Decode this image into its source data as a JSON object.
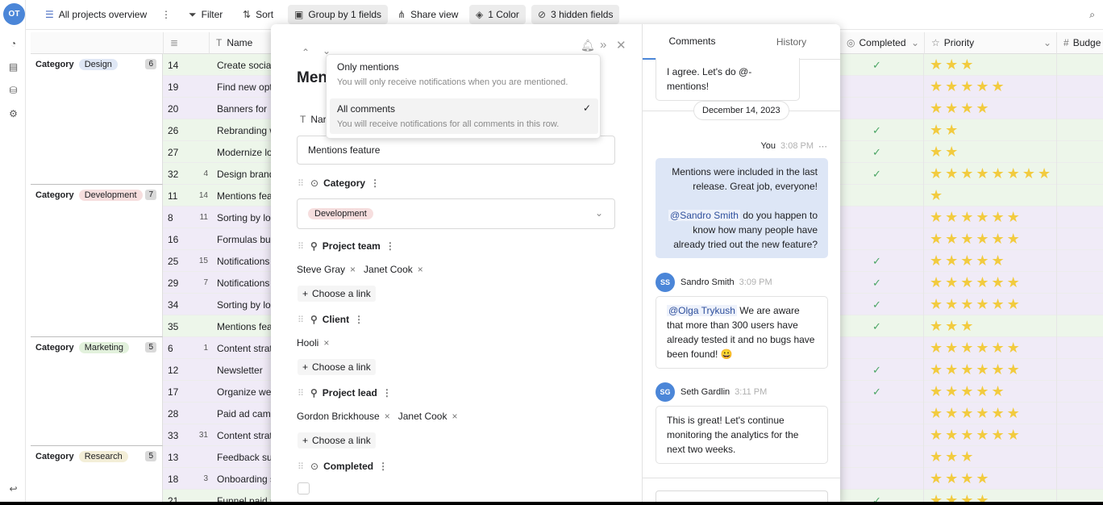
{
  "rail": {
    "avatar": "OT"
  },
  "toolbar": {
    "view_name": "All projects overview",
    "filter": "Filter",
    "sort": "Sort",
    "group": "Group by 1 fields",
    "share": "Share view",
    "color": "1 Color",
    "hidden": "3 hidden fields"
  },
  "grid": {
    "headers": {
      "name": "Name",
      "completed": "Completed",
      "priority": "Priority",
      "budget": "Budge"
    },
    "groups": [
      {
        "label": "Category",
        "value": "Design",
        "count": "6",
        "pill_color": "#dfe7f5",
        "rows": [
          {
            "id": "14",
            "count": "",
            "name": "Create social",
            "completed": "✓",
            "stars": "★★★",
            "tint": "#edf6ea"
          },
          {
            "id": "19",
            "count": "",
            "name": "Find new opt",
            "completed": "",
            "stars": "★★★★★",
            "tint": "#f0ebf7"
          },
          {
            "id": "20",
            "count": "",
            "name": "Banners for",
            "completed": "",
            "stars": "★★★★",
            "tint": "#f0ebf7"
          },
          {
            "id": "26",
            "count": "",
            "name": "Rebranding w",
            "completed": "✓",
            "stars": "★★",
            "tint": "#edf6ea"
          },
          {
            "id": "27",
            "count": "",
            "name": "Modernize lo",
            "completed": "✓",
            "stars": "★★",
            "tint": "#edf6ea"
          },
          {
            "id": "32",
            "count": "4",
            "name": "Design brand",
            "completed": "✓",
            "stars": "★★★★★★★★",
            "tint": "#edf6ea"
          }
        ]
      },
      {
        "label": "Category",
        "value": "Development",
        "count": "7",
        "pill_color": "#f6dede",
        "rows": [
          {
            "id": "11",
            "count": "14",
            "name": "Mentions fea",
            "completed": "",
            "stars": "★",
            "tint": "#edf6ea"
          },
          {
            "id": "8",
            "count": "11",
            "name": "Sorting by lo",
            "completed": "",
            "stars": "★★★★★★",
            "tint": "#f0ebf7"
          },
          {
            "id": "16",
            "count": "",
            "name": "Formulas bug",
            "completed": "",
            "stars": "★★★★★★",
            "tint": "#f0ebf7"
          },
          {
            "id": "25",
            "count": "15",
            "name": "Notifications",
            "completed": "✓",
            "stars": "★★★★★",
            "tint": "#f0ebf7"
          },
          {
            "id": "29",
            "count": "7",
            "name": "Notifications",
            "completed": "✓",
            "stars": "★★★★★★",
            "tint": "#f0ebf7"
          },
          {
            "id": "34",
            "count": "",
            "name": "Sorting by lo",
            "completed": "✓",
            "stars": "★★★★★★",
            "tint": "#f0ebf7"
          },
          {
            "id": "35",
            "count": "",
            "name": "Mentions fea",
            "completed": "✓",
            "stars": "★★★",
            "tint": "#edf6ea"
          }
        ]
      },
      {
        "label": "Category",
        "value": "Marketing",
        "count": "5",
        "pill_color": "#e2f1dc",
        "rows": [
          {
            "id": "6",
            "count": "1",
            "name": "Content strat",
            "completed": "",
            "stars": "★★★★★★",
            "tint": "#f0ebf7"
          },
          {
            "id": "12",
            "count": "",
            "name": "Newsletter",
            "completed": "✓",
            "stars": "★★★★★★",
            "tint": "#f0ebf7"
          },
          {
            "id": "17",
            "count": "",
            "name": "Organize web",
            "completed": "✓",
            "stars": "★★★★★",
            "tint": "#f0ebf7"
          },
          {
            "id": "28",
            "count": "",
            "name": "Paid ad camp",
            "completed": "",
            "stars": "★★★★★★",
            "tint": "#f0ebf7"
          },
          {
            "id": "33",
            "count": "31",
            "name": "Content strat",
            "completed": "",
            "stars": "★★★★★★",
            "tint": "#f0ebf7"
          }
        ]
      },
      {
        "label": "Category",
        "value": "Research",
        "count": "5",
        "pill_color": "#f3eed7",
        "rows": [
          {
            "id": "13",
            "count": "",
            "name": "Feedback sur",
            "completed": "",
            "stars": "★★★",
            "tint": "#f0ebf7"
          },
          {
            "id": "18",
            "count": "3",
            "name": "Onboarding s",
            "completed": "",
            "stars": "★★★★",
            "tint": "#f0ebf7"
          },
          {
            "id": "21",
            "count": "",
            "name": "Funnel paid s",
            "completed": "✓",
            "stars": "★★★★",
            "tint": "#edf6ea"
          }
        ]
      }
    ]
  },
  "modal": {
    "title": "Men",
    "name_field_label": "Nar",
    "name_value": "Mentions feature",
    "category_label": "Category",
    "category_value": "Development",
    "team_label": "Project team",
    "team_members": [
      "Steve Gray",
      "Janet Cook"
    ],
    "choose_link": "Choose a link",
    "client_label": "Client",
    "client_value": "Hooli",
    "lead_label": "Project lead",
    "lead_members": [
      "Gordon Brickhouse",
      "Janet Cook"
    ],
    "completed_label": "Completed"
  },
  "notif_popup": {
    "opt1_title": "Only mentions",
    "opt1_desc": "You will only receive notifications when you are mentioned.",
    "opt2_title": "All comments",
    "opt2_desc": "You will receive notifications for all comments in this row."
  },
  "comments": {
    "tab_comments": "Comments",
    "tab_history": "History",
    "first_bubble": "I agree. Let's do @-mentions!",
    "date": "December 14, 2023",
    "you_label": "You",
    "you_time": "3:08 PM",
    "you_msg1": "Mentions were included in the last release. Great job, everyone!",
    "you_mention": "@Sandro Smith",
    "you_msg2": "do you happen to know how many people have already tried out the new feature?",
    "c1_initials": "SS",
    "c1_name": "Sandro Smith",
    "c1_time": "3:09 PM",
    "c1_mention": "@Olga Trykush",
    "c1_text": "We are aware that more than 300 users have already tested it and no bugs have been found! 😀",
    "c2_initials": "SG",
    "c2_name": "Seth Gardlin",
    "c2_time": "3:11 PM",
    "c2_text": "This is great! Let's continue monitoring the analytics for the next two weeks."
  }
}
